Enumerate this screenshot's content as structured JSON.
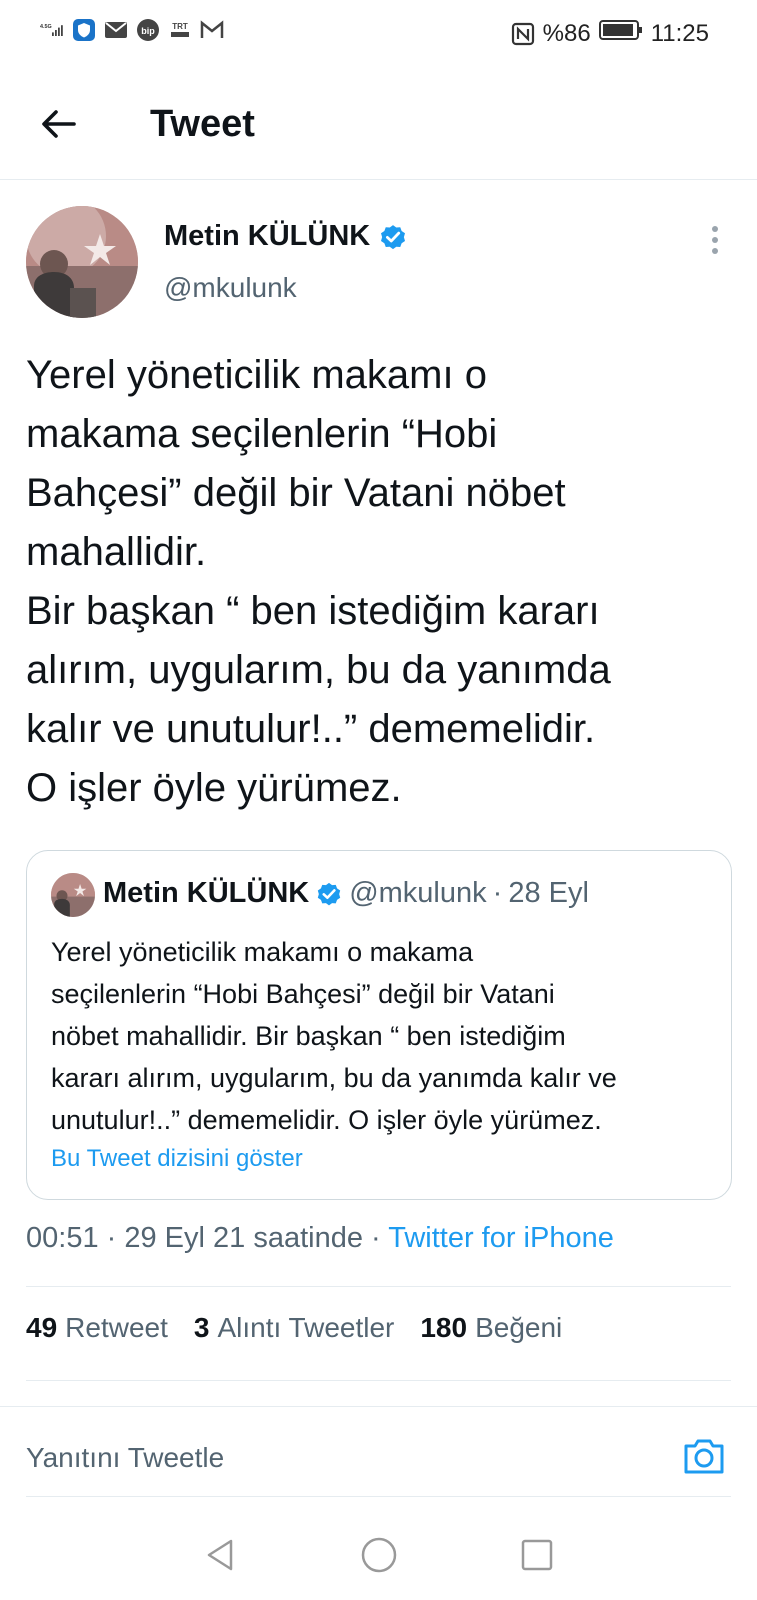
{
  "status_bar": {
    "network": "4.5G",
    "battery": "%86",
    "time": "11:25",
    "icons": [
      "signal-icon",
      "shield-app-icon",
      "mail-icon",
      "bip-app-icon",
      "trt-haber-icon",
      "gmail-icon",
      "nfc-icon",
      "battery-icon"
    ]
  },
  "header": {
    "title": "Tweet",
    "back_icon": "arrow-left-icon"
  },
  "author": {
    "name": "Metin KÜLÜNK",
    "handle": "@mkulunk",
    "verified": true
  },
  "tweet": {
    "lines": [
      "Yerel yöneticilik makamı o",
      "makama seçilenlerin “Hobi",
      "Bahçesi” değil bir Vatani nöbet",
      "mahallidir.",
      "Bir başkan “ ben istediğim kararı",
      "alırım, uygularım, bu da yanımda",
      "kalır ve unutulur!..” dememelidir.",
      "O işler öyle yürümez."
    ]
  },
  "quote": {
    "name": "Metin KÜLÜNK",
    "handle": "@mkulunk",
    "separator": "·",
    "date": "28 Eyl",
    "lines": [
      "Yerel yöneticilik makamı o makama",
      "seçilenlerin “Hobi Bahçesi” değil bir Vatani",
      "nöbet mahallidir. Bir başkan “ ben istediğim",
      "kararı alırım, uygularım, bu da yanımda kalır ve",
      "unutulur!..” dememelidir. O işler öyle yürümez."
    ],
    "show_thread": "Bu Tweet dizisini göster"
  },
  "meta": {
    "timestamp": "00:51 · 29 Eyl 21 saatinde · ",
    "source": "Twitter for iPhone"
  },
  "stats": {
    "retweets_count": "49",
    "retweets_label": "Retweet",
    "quotes_count": "3",
    "quotes_label": "Alıntı Tweetler",
    "likes_count": "180",
    "likes_label": "Beğeni"
  },
  "reply": {
    "placeholder": "Yanıtını Tweetle"
  },
  "colors": {
    "accent": "#1d9bf0",
    "text": "#0f1419",
    "secondary": "#536471",
    "border": "#cfd9de"
  }
}
